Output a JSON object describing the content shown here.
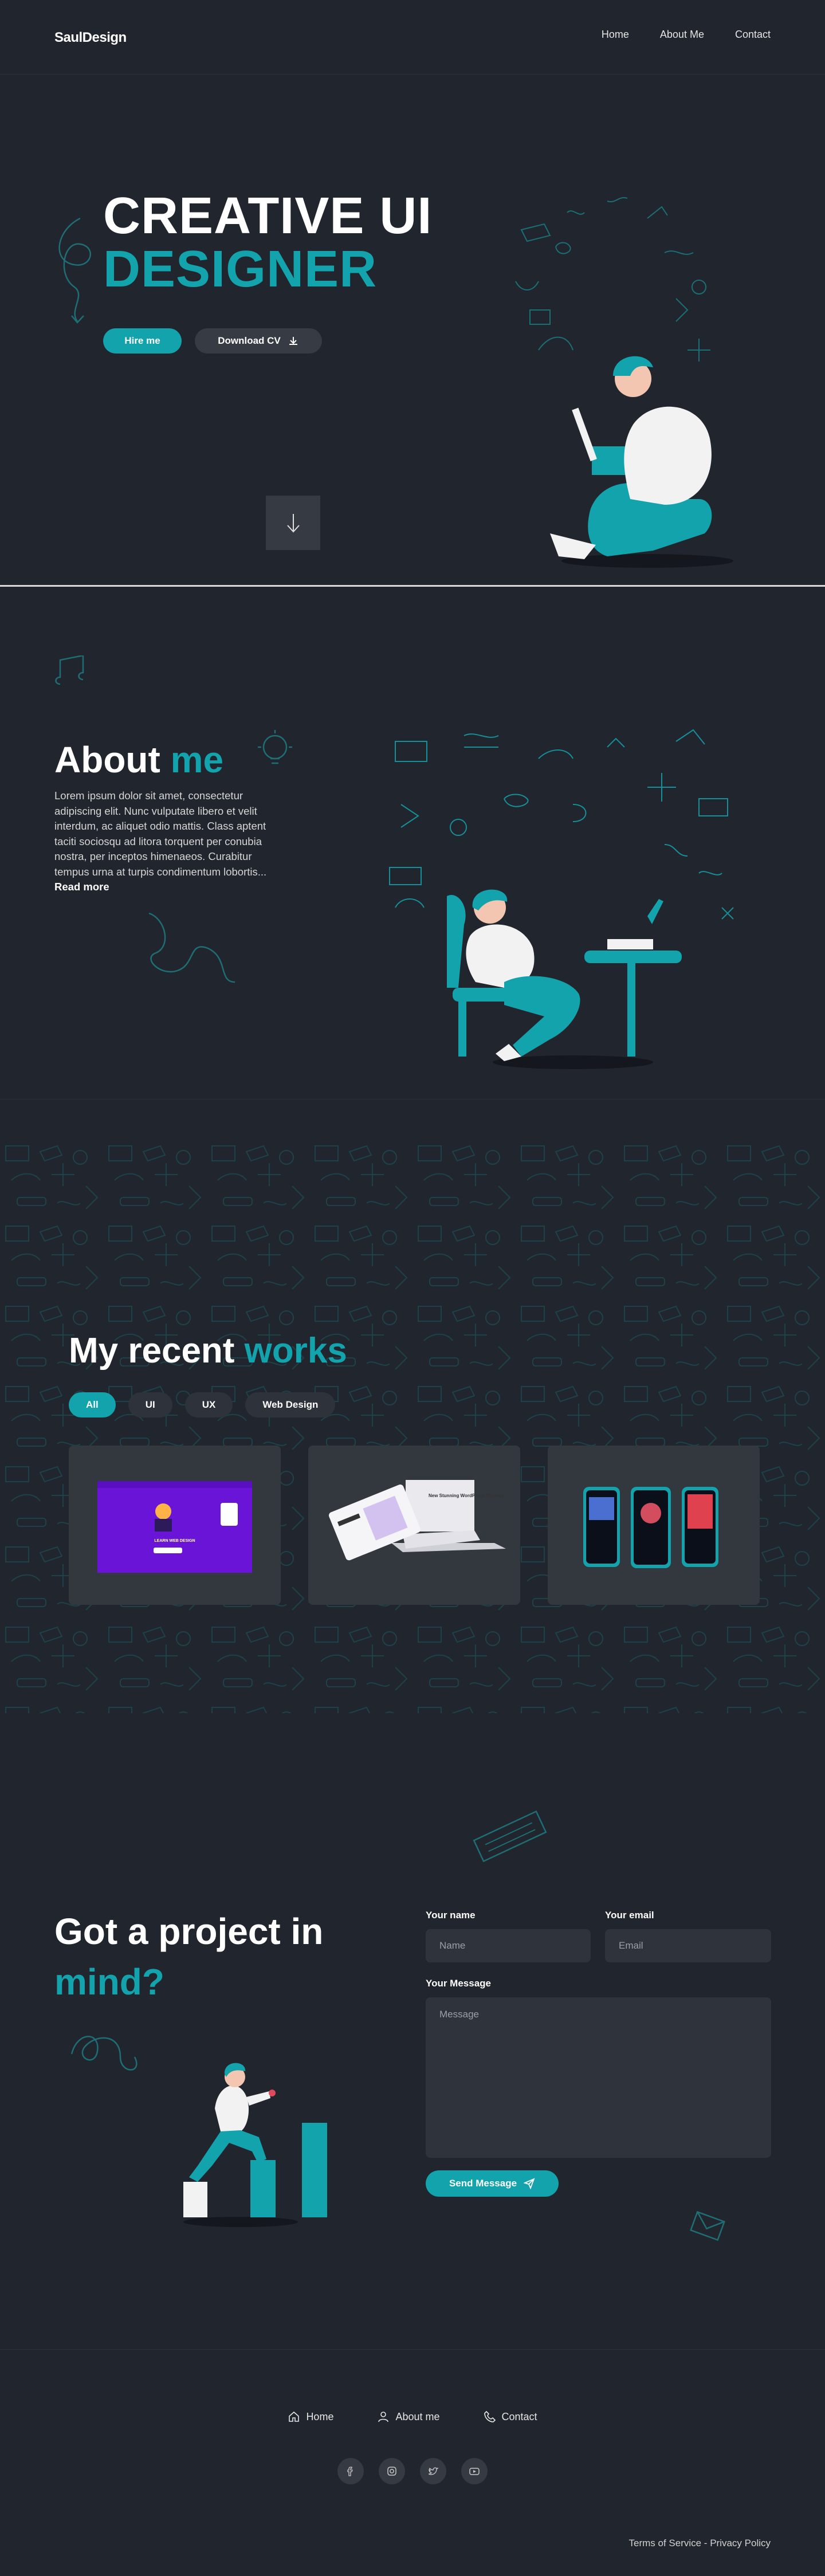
{
  "header": {
    "logo": "SaulDesign",
    "nav": [
      {
        "label": "Home"
      },
      {
        "label": "About Me"
      },
      {
        "label": "Contact"
      }
    ]
  },
  "hero": {
    "title_line1": "CREATIVE UI",
    "title_line2": "DESIGNER",
    "hire_label": "Hire me",
    "cv_label": "Download CV",
    "scroll_icon": "arrow-down-icon"
  },
  "about": {
    "title_main": "About ",
    "title_accent": "me",
    "body": "Lorem ipsum dolor sit amet, consectetur adipiscing elit. Nunc vulputate libero et velit interdum, ac aliquet odio mattis. Class aptent taciti sociosqu ad litora torquent per conubia nostra, per inceptos himenaeos. Curabitur tempus urna at turpis condimentum lobortis... ",
    "read_more": "Read more"
  },
  "works": {
    "title_main": "My recent ",
    "title_accent": "works",
    "filters": [
      {
        "label": "All",
        "active": true
      },
      {
        "label": "UI",
        "active": false
      },
      {
        "label": "UX",
        "active": false
      },
      {
        "label": "Web Design",
        "active": false
      }
    ],
    "card1_heading": "LEARN WEB DESIGN",
    "card2_heading": "New Stunning WordPress Website"
  },
  "contact": {
    "title_line1": "Got a project in",
    "title_line2": "mind?",
    "name_label": "Your name",
    "name_placeholder": "Name",
    "email_label": "Your email",
    "email_placeholder": "Email",
    "message_label": "Your Message",
    "message_placeholder": "Message",
    "send_label": "Send Message"
  },
  "footer": {
    "nav": [
      {
        "label": "Home",
        "icon": "home-icon"
      },
      {
        "label": "About me",
        "icon": "user-icon"
      },
      {
        "label": "Contact",
        "icon": "phone-icon"
      }
    ],
    "socials": [
      "facebook-icon",
      "instagram-icon",
      "twitter-icon",
      "youtube-icon"
    ],
    "legal": "Terms of Service - Privacy Policy"
  },
  "colors": {
    "background": "#21252d",
    "accent": "#13a3ad",
    "surface": "#2f343c"
  }
}
